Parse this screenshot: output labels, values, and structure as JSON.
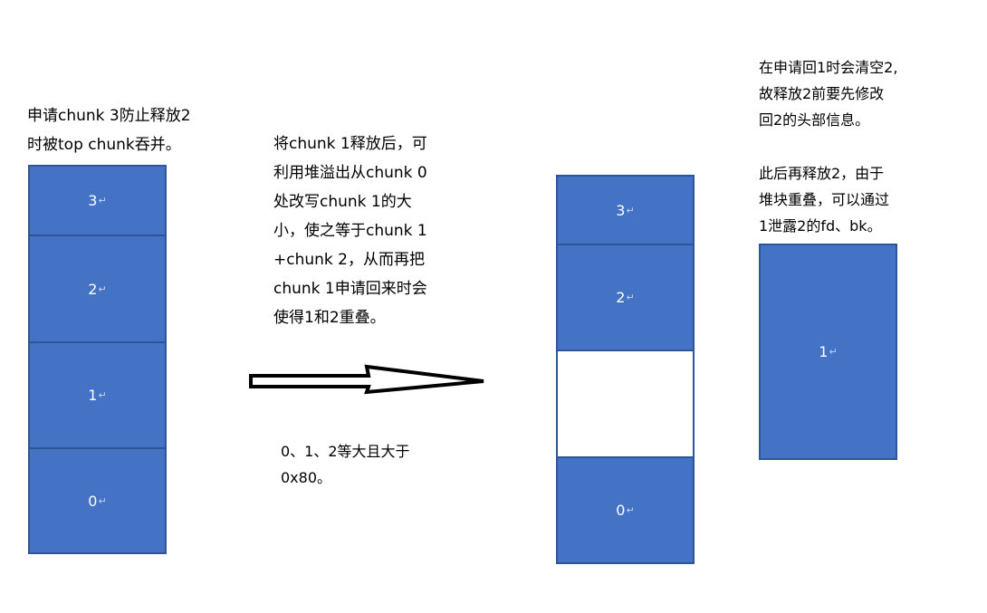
{
  "left_note": "申请chunk 3防止释放2\n时被top chunk吞并。",
  "left_stack": [
    {
      "label": "3"
    },
    {
      "label": "2"
    },
    {
      "label": "1"
    },
    {
      "label": "0"
    }
  ],
  "middle_note": "将chunk 1释放后，可\n利用堆溢出从chunk 0\n处改写chunk 1的大\n小，使之等于chunk 1\n+chunk 2，从而再把\nchunk 1申请回来时会\n使得1和2重叠。",
  "size_note": "0、1、2等大且大于\n0x80。",
  "right_stack": [
    {
      "label": "3"
    },
    {
      "label": "2"
    },
    {
      "label": ""
    },
    {
      "label": "0"
    }
  ],
  "right_note_1": "在申请回1时会清空2,\n故释放2前要先修改\n回2的头部信息。",
  "right_note_2": "此后再释放2，由于\n堆块重叠，可以通过\n1泄露2的fd、bk。",
  "merged_chunk": {
    "label": "1"
  },
  "para_mark": "↵",
  "colors": {
    "chunk_fill": "#4472c4",
    "chunk_border": "#2f5597",
    "freed_fill": "#ffffff"
  }
}
